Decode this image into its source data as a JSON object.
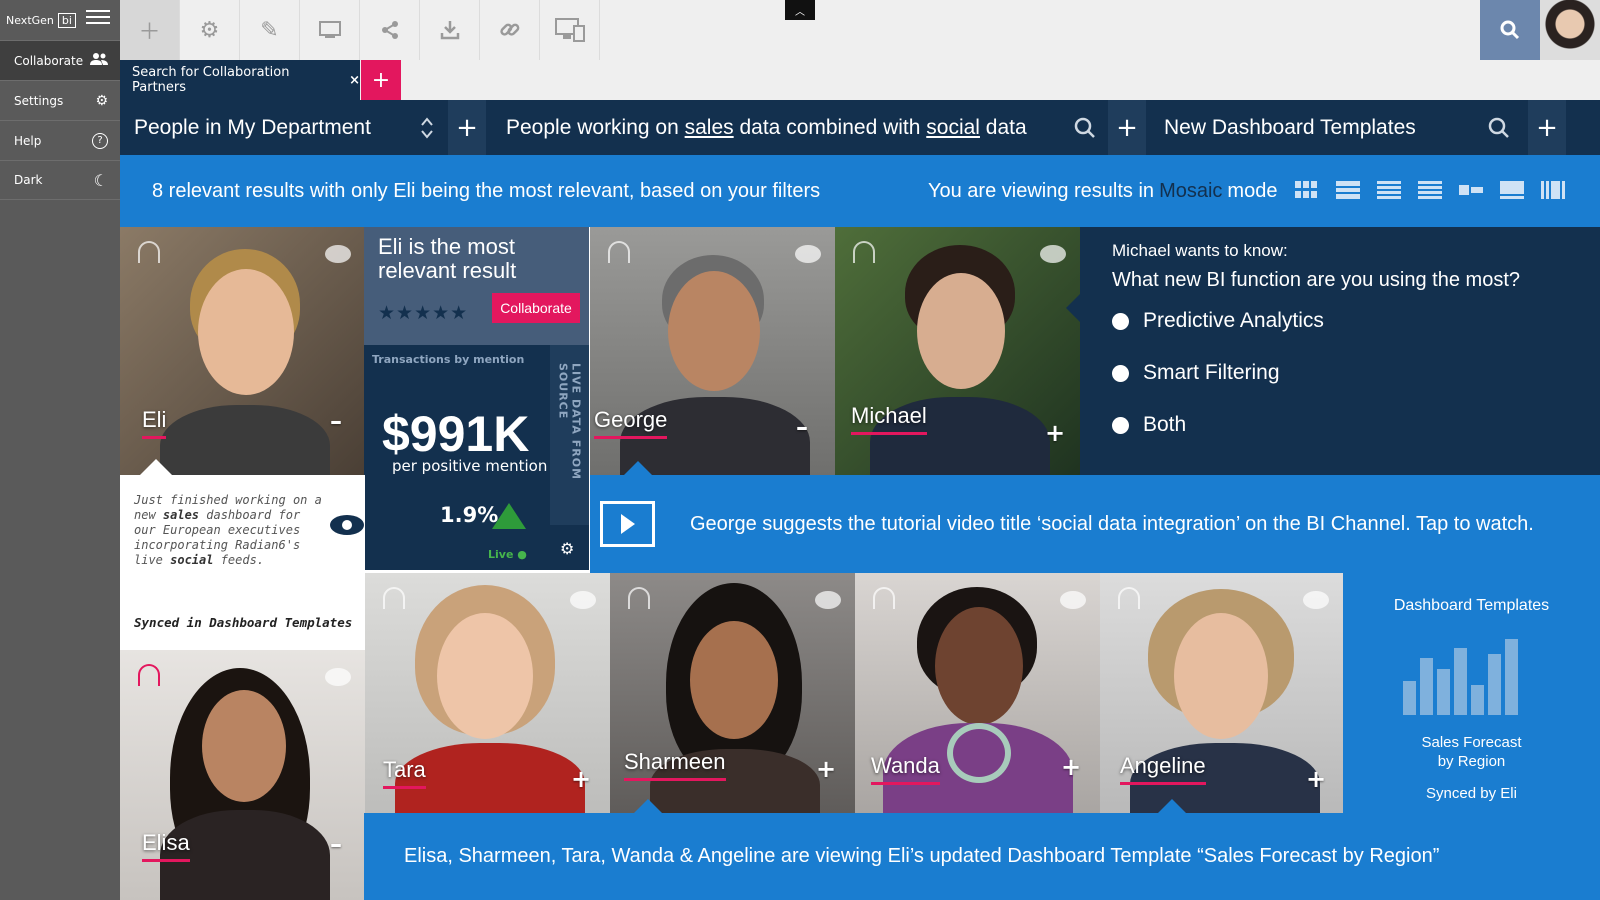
{
  "sidebar": {
    "logo": {
      "text": "NextGen",
      "badge": "bi"
    },
    "items": [
      {
        "label": "Collaborate",
        "icon": "users-icon"
      },
      {
        "label": "Settings",
        "icon": "gears-icon"
      },
      {
        "label": "Help",
        "icon": "help-icon"
      },
      {
        "label": "Dark",
        "icon": "moon-icon"
      }
    ]
  },
  "toolbar": {
    "buttons": [
      "plus-icon",
      "gear-icon",
      "pencil-icon",
      "screen-icon",
      "share-icon",
      "download-icon",
      "link-icon",
      "devices-icon"
    ]
  },
  "tabs": {
    "active_label": "Search for Collaboration Partners",
    "close_glyph": "×",
    "add_glyph": "+"
  },
  "queries": {
    "q1": "People in My Department",
    "q2_parts": [
      "People working on ",
      "sales",
      " data combined with ",
      "social",
      " data"
    ],
    "q3": "New Dashboard Templates"
  },
  "info": {
    "left": "8 relevant results with only Eli being the most relevant, based on your filters",
    "right_prefix": "You are viewing results in",
    "right_mode": "Mosaic",
    "right_suffix": "mode"
  },
  "people": {
    "eli": {
      "name": "Eli",
      "action": "–"
    },
    "george": {
      "name": "George",
      "action": "–"
    },
    "michael": {
      "name": "Michael",
      "action": "+"
    },
    "elisa": {
      "name": "Elisa",
      "action": "–"
    },
    "tara": {
      "name": "Tara",
      "action": "+"
    },
    "sharmeen": {
      "name": "Sharmeen",
      "action": "+"
    },
    "wanda": {
      "name": "Wanda",
      "action": "+"
    },
    "angeline": {
      "name": "Angeline",
      "action": "+"
    }
  },
  "eli_panel": {
    "title": "Eli is the most relevant result",
    "stars": "★★★★★",
    "rating": 5,
    "button": "Collaborate"
  },
  "transactions": {
    "title": "Transactions by mention",
    "value": "$991K",
    "subtitle": "per positive mention",
    "percent": "1.9%",
    "live": "Live",
    "vertical": "LIVE DATA FROM SOURCE"
  },
  "eli_note": {
    "parts": [
      "Just finished working on a new ",
      "sales",
      " dashboard for our European executives incorporating Radian6's live ",
      "social",
      " feeds."
    ],
    "synced": "Synced in Dashboard Templates"
  },
  "poll": {
    "asker": "Michael wants to know:",
    "question": "What new BI function are you using the most?",
    "options": [
      "Predictive Analytics",
      "Smart Filtering",
      "Both"
    ]
  },
  "video": {
    "text": "George suggests the tutorial video title ‘social data integration’ on the BI Channel. Tap to watch."
  },
  "dashboard_template": {
    "title": "Dashboard Templates",
    "name": "Sales Forecast by Region",
    "synced": "Synced by Eli"
  },
  "bottom": {
    "text": "Elisa, Sharmeen, Tara, Wanda & Angeline are viewing Eli’s updated Dashboard Template “Sales Forecast by Region”"
  },
  "colors": {
    "navy": "#13304e",
    "blue": "#1a7dd0",
    "accent": "#e3175e",
    "sidebar": "#5a5a5a"
  }
}
